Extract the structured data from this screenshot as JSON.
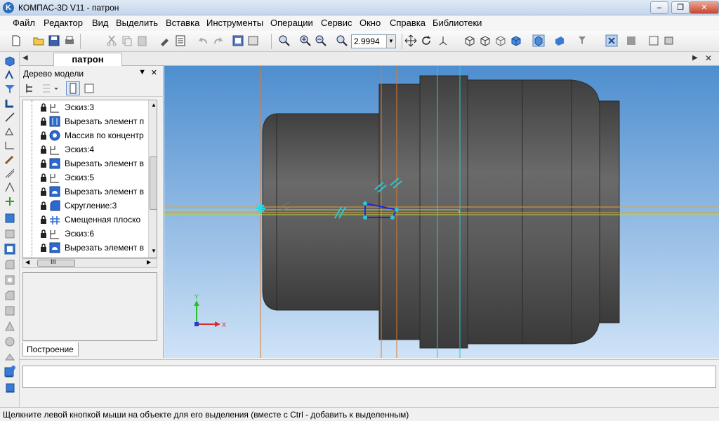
{
  "window": {
    "title": "КОМПАС-3D V11 - патрон",
    "app_icon": "K"
  },
  "menu": [
    "Файл",
    "Редактор",
    "Вид",
    "Выделить",
    "Вставка",
    "Инструменты",
    "Операции",
    "Сервис",
    "Окно",
    "Справка",
    "Библиотеки"
  ],
  "toolbar": {
    "zoom_value": "2.9994"
  },
  "doc_tab": {
    "label": "патрон"
  },
  "tree": {
    "title": "Дерево модели",
    "items": [
      {
        "label": "Эскиз:3",
        "icon": "sketch-icon"
      },
      {
        "label": "Вырезать элемент п",
        "icon": "cut-extrude-icon"
      },
      {
        "label": "Массив по концентр",
        "icon": "circular-pattern-icon"
      },
      {
        "label": "Эскиз:4",
        "icon": "sketch-icon"
      },
      {
        "label": "Вырезать элемент в",
        "icon": "cut-revolve-icon"
      },
      {
        "label": "Эскиз:5",
        "icon": "sketch-icon"
      },
      {
        "label": "Вырезать элемент в",
        "icon": "cut-revolve-icon"
      },
      {
        "label": "Скругление:3",
        "icon": "fillet-icon"
      },
      {
        "label": "Смещенная плоско",
        "icon": "offset-plane-icon"
      },
      {
        "label": "Эскиз:6",
        "icon": "sketch-icon"
      },
      {
        "label": "Вырезать элемент в",
        "icon": "cut-revolve-icon"
      }
    ],
    "scroll_grip": "III",
    "bottom_tab": "Построение"
  },
  "viewport": {
    "axis_x_label": "X",
    "axis_y_label": "Y",
    "background_top": "#4e8ecf",
    "background_bottom": "#cfe3f7",
    "body_color": "#5a5a5a"
  },
  "status": {
    "text": "Щелкните левой кнопкой мыши на объекте для его выделения (вместе с Ctrl - добавить к выделенным)"
  }
}
